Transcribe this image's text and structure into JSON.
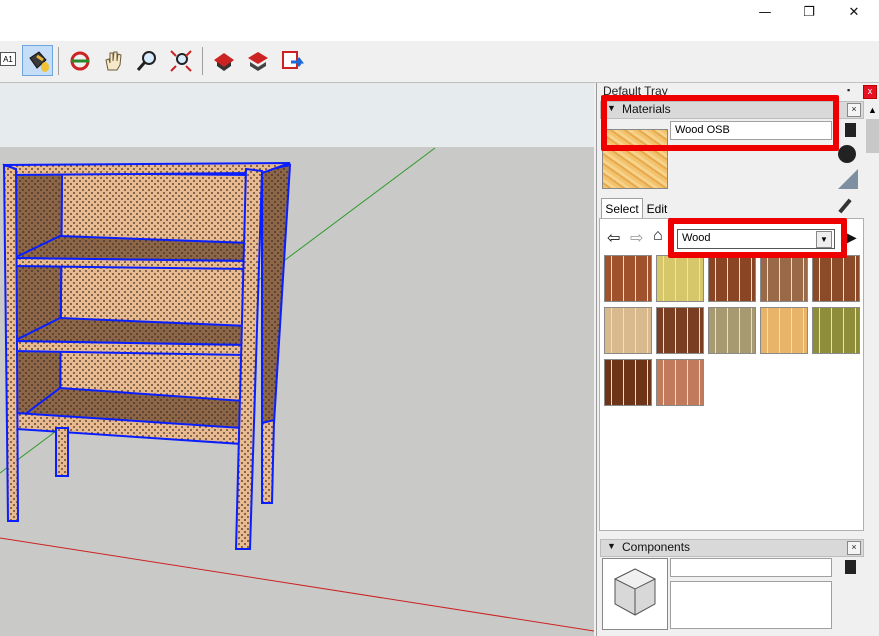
{
  "window": {
    "minimize_glyph": "—",
    "restore_glyph": "❐",
    "close_glyph": "✕"
  },
  "toolbar": {
    "badge_text": "A1",
    "tools": [
      "paint-bucket-icon",
      "orbit-icon",
      "pan-icon",
      "zoom-icon",
      "zoom-extents-icon",
      "warehouse-icon",
      "extension-warehouse-icon",
      "share-model-icon"
    ]
  },
  "tray": {
    "title": "Default Tray",
    "pin_glyph": "📌",
    "close_glyph": "x"
  },
  "materials": {
    "header": "Materials",
    "current_name": "Wood OSB",
    "tab_select": "Select",
    "tab_edit": "Edit",
    "library": "Wood",
    "swatch_colors": [
      "#a0522d",
      "#d6c86a",
      "#8a4524",
      "#9a6a48",
      "#8b4a28",
      "#d9b98e",
      "#7a3f22",
      "#a89a70",
      "#e8b46a",
      "#8e8d3a",
      "#6e3418",
      "#c27a5c"
    ]
  },
  "components": {
    "header": "Components"
  },
  "colors": {
    "accent_red": "#ee0000",
    "selection_blue": "#0a1fff"
  }
}
